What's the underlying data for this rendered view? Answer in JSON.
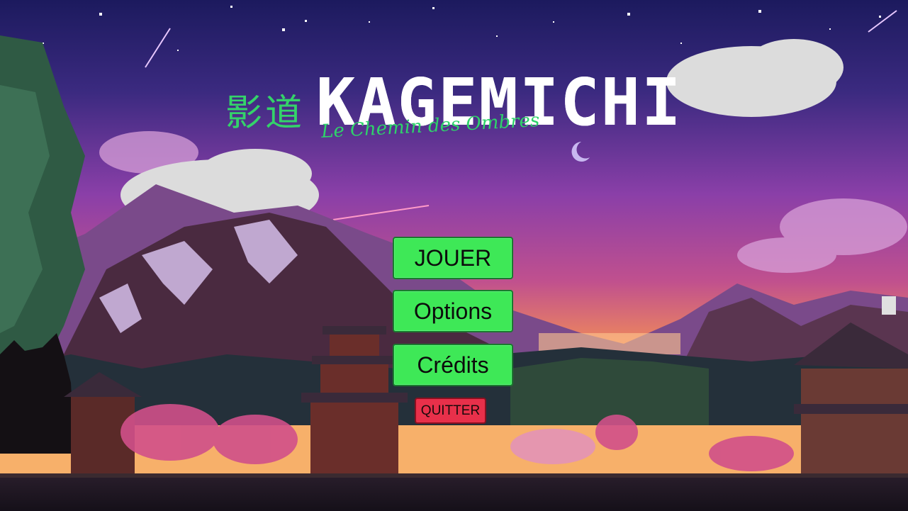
{
  "title": {
    "kanji": "影道",
    "name": "KAGEMICHI",
    "subtitle": "Le Chemin des Ombres"
  },
  "menu": {
    "play": "JOUER",
    "options": "Options",
    "credits": "Crédits",
    "quit": "QUITTER"
  },
  "colors": {
    "button_green": "#3ee857",
    "button_red": "#e8304a",
    "title_green": "#34d36a",
    "sky_top": "#1c1a5e",
    "sky_mid": "#8a3fa8",
    "sky_low": "#f08a5a"
  }
}
